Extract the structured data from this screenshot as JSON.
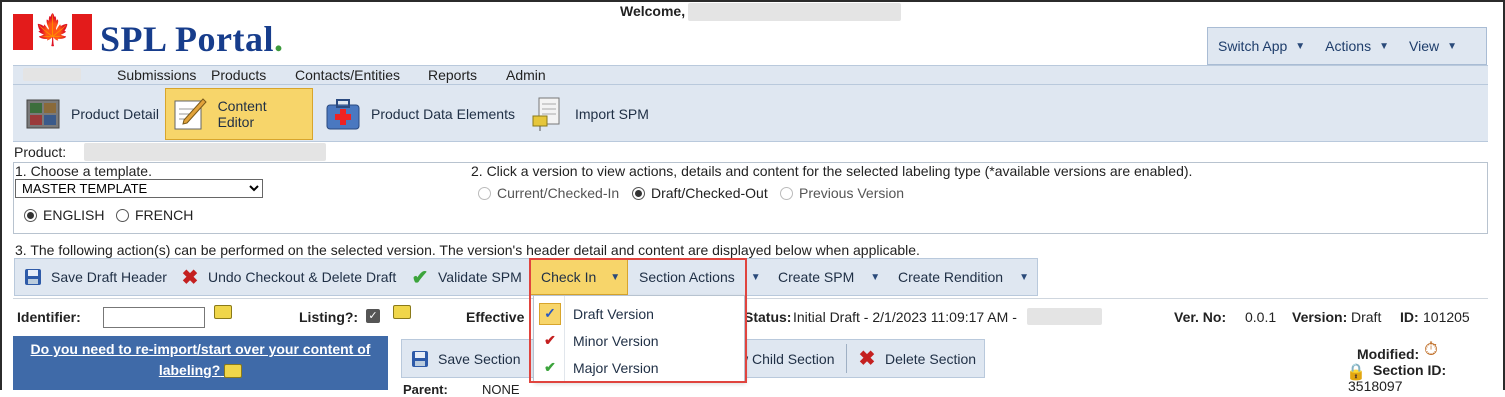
{
  "header": {
    "welcome": "Welcome,",
    "app_title": "SPL Portal",
    "app_title_dot": "."
  },
  "top_menu": [
    {
      "label": "Switch App"
    },
    {
      "label": "Actions"
    },
    {
      "label": "View"
    }
  ],
  "nav": {
    "items": [
      "Submissions",
      "Products",
      "Contacts/Entities",
      "Reports",
      "Admin"
    ]
  },
  "toolbar": {
    "items": [
      {
        "label": "Product Detail",
        "icon": "product-detail-icon"
      },
      {
        "label": "Content Editor",
        "icon": "content-editor-icon",
        "active": true
      },
      {
        "label": "Product Data Elements",
        "icon": "product-data-elements-icon"
      },
      {
        "label": "Import SPM",
        "icon": "import-spm-icon"
      }
    ]
  },
  "product": {
    "label": "Product:"
  },
  "step1": {
    "label": "1. Choose a template.",
    "template_value": "MASTER TEMPLATE",
    "languages": [
      {
        "label": "ENGLISH",
        "selected": true
      },
      {
        "label": "FRENCH",
        "selected": false
      }
    ]
  },
  "step2": {
    "label": "2. Click a version to view actions, details and content for the selected labeling type (*available versions are enabled).",
    "versions": [
      {
        "label": "Current/Checked-In",
        "selected": false,
        "enabled": false
      },
      {
        "label": "Draft/Checked-Out",
        "selected": true,
        "enabled": true
      },
      {
        "label": "Previous Version",
        "selected": false,
        "enabled": false
      }
    ]
  },
  "step3": {
    "label": "3. The following action(s) can be performed on the selected version. The version's header detail and content are displayed below when applicable."
  },
  "actions": [
    {
      "label": "Save Draft Header",
      "icon": "save-icon"
    },
    {
      "label": "Undo Checkout & Delete Draft",
      "icon": "red-x-icon"
    },
    {
      "label": "Validate SPM",
      "icon": "green-check-icon"
    },
    {
      "label": "Check In",
      "active": true
    },
    {
      "label": "Section Actions"
    },
    {
      "label": "Create SPM"
    },
    {
      "label": "Create Rendition"
    }
  ],
  "check_in_menu": [
    {
      "label": "Draft Version",
      "icon": "draft-check-icon"
    },
    {
      "label": "Minor Version",
      "icon": "minor-check-icon"
    },
    {
      "label": "Major Version",
      "icon": "major-check-icon"
    }
  ],
  "fields": {
    "identifier_label": "Identifier:",
    "listing_label": "Listing?:",
    "listing_checked": true,
    "effective_label": "Effective",
    "status_label": "Status:",
    "status_value": "Initial Draft - 2/1/2023 11:09:17 AM -",
    "ver_no_label": "Ver. No:",
    "ver_no_value": "0.0.1",
    "version_label": "Version:",
    "version_value": "Draft",
    "id_label": "ID:",
    "id_value": "101205"
  },
  "left_panel": {
    "link_line1": "Do you need to re-import/start over your content of",
    "link_line2": "labeling?"
  },
  "section_bar": [
    {
      "label": "Save Section",
      "icon": "save-icon"
    },
    {
      "label": "w Child Section"
    },
    {
      "label": "Delete Section",
      "icon": "red-x-icon"
    }
  ],
  "section_meta": {
    "modified_label": "Modified:",
    "section_id_label": "Section ID:",
    "section_id_value": "3518097",
    "parent_label": "Parent:",
    "parent_value": "NONE"
  },
  "colors": {
    "accent_yellow": "#f7d56a",
    "toolbar_bg": "#dfe7f1",
    "panel_blue": "#3f6aa8",
    "highlight_red": "#e0443e",
    "brand_blue": "#173d8c"
  }
}
